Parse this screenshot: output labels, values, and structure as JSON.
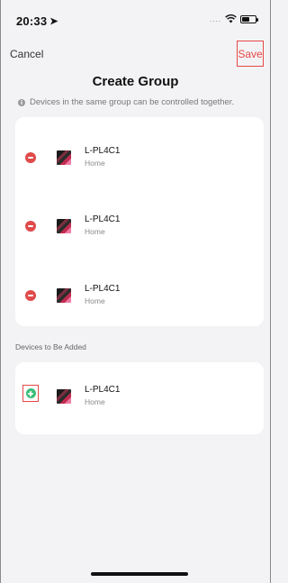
{
  "status_bar": {
    "time": "20:33",
    "location_icon": "location-arrow-icon",
    "signal_text": "....",
    "wifi_icon": "wifi-icon",
    "battery_icon": "battery-icon",
    "battery_level": 0.55
  },
  "nav": {
    "cancel_label": "Cancel",
    "save_label": "Save"
  },
  "title": "Create Group",
  "notice": {
    "icon": "info-icon",
    "text": "Devices in the same group can be controlled together."
  },
  "group_devices": [
    {
      "name": "L-PL4C1",
      "room": "Home",
      "action_icon": "remove-circle-icon"
    },
    {
      "name": "L-PL4C1",
      "room": "Home",
      "action_icon": "remove-circle-icon"
    },
    {
      "name": "L-PL4C1",
      "room": "Home",
      "action_icon": "remove-circle-icon"
    }
  ],
  "to_add_section_label": "Devices to Be Added",
  "devices_to_add": [
    {
      "name": "L-PL4C1",
      "room": "Home",
      "action_icon": "add-circle-icon"
    }
  ],
  "colors": {
    "background": "#f3f3f5",
    "card": "#ffffff",
    "remove": "#e04a4a",
    "add": "#3cbf7a",
    "highlight_border": "#e84848"
  }
}
